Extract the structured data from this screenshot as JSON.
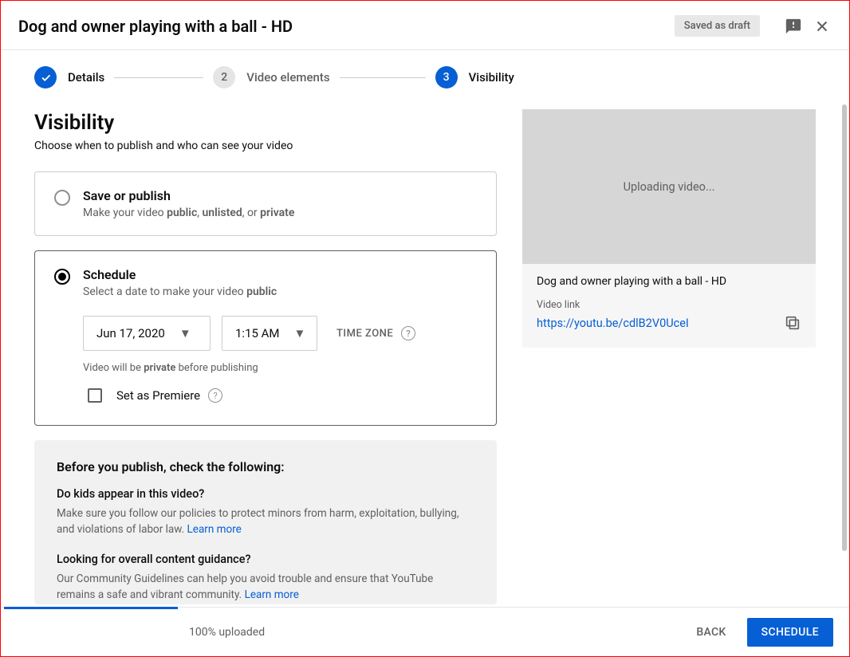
{
  "header": {
    "title": "Dog and owner playing with a ball - HD",
    "saved_badge": "Saved as draft"
  },
  "stepper": {
    "steps": [
      {
        "label": "Details",
        "state": "done"
      },
      {
        "num": "2",
        "label": "Video elements",
        "state": "inactive"
      },
      {
        "num": "3",
        "label": "Visibility",
        "state": "active"
      }
    ]
  },
  "page": {
    "heading": "Visibility",
    "sub": "Choose when to publish and who can see your video"
  },
  "option_publish": {
    "title": "Save or publish",
    "desc_pre": "Make your video ",
    "desc_b1": "public",
    "desc_sep1": ", ",
    "desc_b2": "unlisted",
    "desc_sep2": ", or ",
    "desc_b3": "private"
  },
  "option_schedule": {
    "title": "Schedule",
    "desc_pre": "Select a date to make your video ",
    "desc_b1": "public",
    "date_value": "Jun 17, 2020",
    "time_value": "1:15 AM",
    "tz_label": "TIME ZONE",
    "private_note_pre": "Video will be ",
    "private_note_b": "private",
    "private_note_post": " before publishing",
    "premiere_label": "Set as Premiere"
  },
  "checklist": {
    "title": "Before you publish, check the following:",
    "q1": "Do kids appear in this video?",
    "q1_desc": "Make sure you follow our policies to protect minors from harm, exploitation, bullying, and violations of labor law. ",
    "q1_link": "Learn more",
    "q2": "Looking for overall content guidance?",
    "q2_desc": "Our Community Guidelines can help you avoid trouble and ensure that YouTube remains a safe and vibrant community. ",
    "q2_link": "Learn more"
  },
  "preview": {
    "uploading": "Uploading video...",
    "video_title": "Dog and owner playing with a ball - HD",
    "link_label": "Video link",
    "link": "https://youtu.be/cdlB2V0UceI"
  },
  "footer": {
    "upload_status": "100% uploaded",
    "back": "BACK",
    "schedule": "SCHEDULE"
  }
}
